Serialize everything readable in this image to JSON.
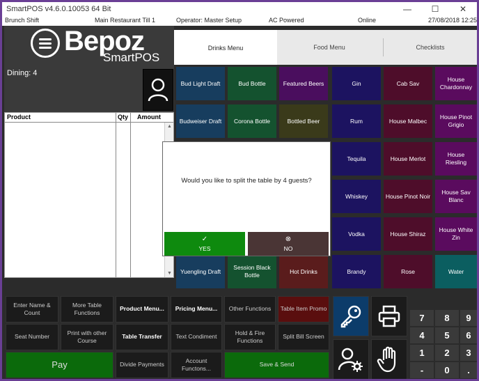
{
  "window": {
    "title": "SmartPOS v4.6.0.10053 64 Bit",
    "controls": {
      "minimize": "—",
      "maximize": "☐",
      "close": "✕"
    }
  },
  "status": {
    "shift": "Brunch Shift",
    "till": "Main Restaurant Till 1",
    "operator": "Operator: Master Setup",
    "power": "AC Powered",
    "connection": "Online",
    "datetime": "27/08/2018 12:25"
  },
  "brand": {
    "name": "Bepoz",
    "sub": "SmartPOS"
  },
  "dining": {
    "label": "Dining: 4"
  },
  "order_table": {
    "columns": [
      "Product",
      "Qty",
      "Amount"
    ],
    "rows": []
  },
  "tabs": [
    {
      "label": "Drinks Menu",
      "active": true
    },
    {
      "label": "Food Menu",
      "active": false
    },
    {
      "label": "Checklists",
      "active": false
    }
  ],
  "products": {
    "col1": [
      "Bud Light Draft",
      "Budweiser Draft",
      "",
      "",
      "",
      "Yuengling Draft"
    ],
    "col2": [
      "Bud Bottle",
      "Corona Bottle",
      "",
      "",
      "",
      "Session Black Bottle"
    ],
    "col3": [
      "Featured Beers",
      "Bottled Beer",
      "",
      "",
      "",
      "Hot Drinks"
    ],
    "col4": [
      "Gin",
      "Rum",
      "Tequila",
      "Whiskey",
      "Vodka",
      "Brandy"
    ],
    "col5": [
      "Cab Sav",
      "House Malbec",
      "House Merlot",
      "House Pinot Noir",
      "House Shiraz",
      "Rose"
    ],
    "col6": [
      "House Chardonnay",
      "House Pinot Grigio",
      "House Riesling",
      "House Sav Blanc",
      "House White Zin",
      "Water"
    ]
  },
  "functions": {
    "enter_name": "Enter Name & Count",
    "more_table": "More Table Functions",
    "product_menu": "Product Menu...",
    "pricing_menu": "Pricing Menu...",
    "other_functions": "Other Functions",
    "table_item_promo": "Table Item Promo",
    "seat_number": "Seat Number",
    "print_other_course": "Print with other Course",
    "table_transfer": "Table Transfer",
    "text_condiment": "Text Condiment",
    "hold_fire": "Hold & Fire Functions",
    "split_bill": "Split Bill Screen",
    "pay": "Pay",
    "divide_payments": "Divide Payments",
    "account_functions": "Account Functons...",
    "save_send": "Save & Send"
  },
  "keypad": [
    "7",
    "8",
    "9",
    "4",
    "5",
    "6",
    "1",
    "2",
    "3",
    "-",
    "0",
    "."
  ],
  "modal": {
    "message": "Would you like to split the table by 4 guests?",
    "yes": "YES",
    "no": "NO"
  },
  "colors": {
    "frame": "#6a3f95",
    "blue": "#173d5e",
    "green": "#14522f",
    "purple": "#4a0e5e",
    "navy": "#1c1360",
    "maroon": "#4e0d2a",
    "plum": "#5a0b5e",
    "teal": "#0b5e60",
    "brown": "#5a1c1c",
    "olive": "#3a3a1a",
    "yes": "#0e8a0e",
    "no": "#4a3535"
  }
}
